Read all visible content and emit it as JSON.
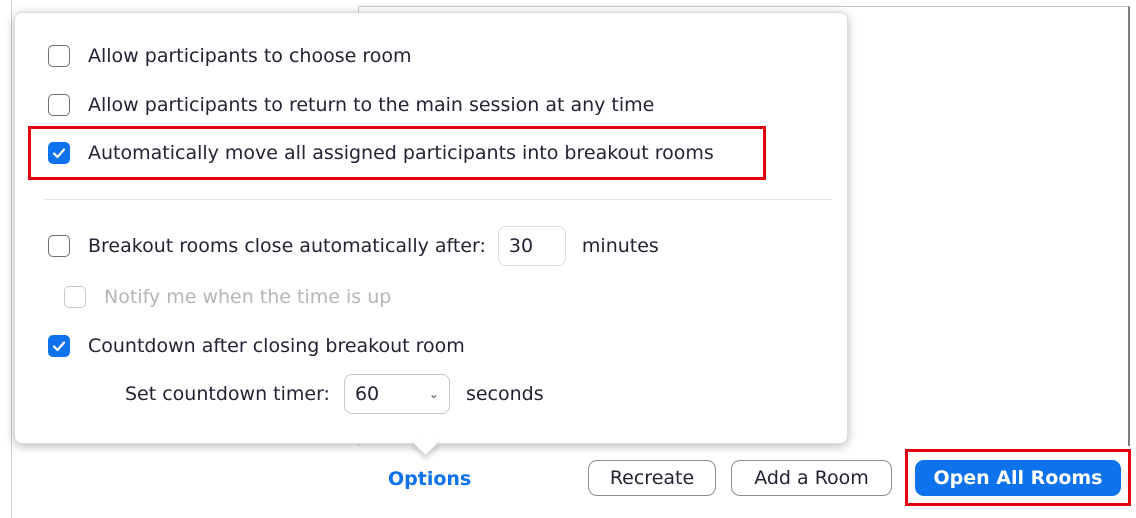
{
  "options": {
    "allow_choose_room": {
      "label": "Allow participants to choose room",
      "checked": false
    },
    "allow_return": {
      "label": "Allow participants to return to the main session at any time",
      "checked": false
    },
    "auto_move": {
      "label": "Automatically move all assigned participants into breakout rooms",
      "checked": true
    },
    "close_automatically": {
      "label": "Breakout rooms close automatically after:",
      "value": "30",
      "unit": "minutes",
      "checked": false
    },
    "notify": {
      "label": "Notify me when the time is up",
      "checked": false,
      "disabled": true
    },
    "countdown": {
      "label": "Countdown after closing breakout room",
      "checked": true
    },
    "countdown_timer": {
      "label": "Set countdown timer:",
      "value": "60",
      "unit": "seconds"
    }
  },
  "footer": {
    "options_link": "Options",
    "recreate_label": "Recreate",
    "add_room_label": "Add a Room",
    "open_all_label": "Open All Rooms"
  },
  "colors": {
    "accent": "#0e72ed",
    "highlight": "#e2000f"
  }
}
